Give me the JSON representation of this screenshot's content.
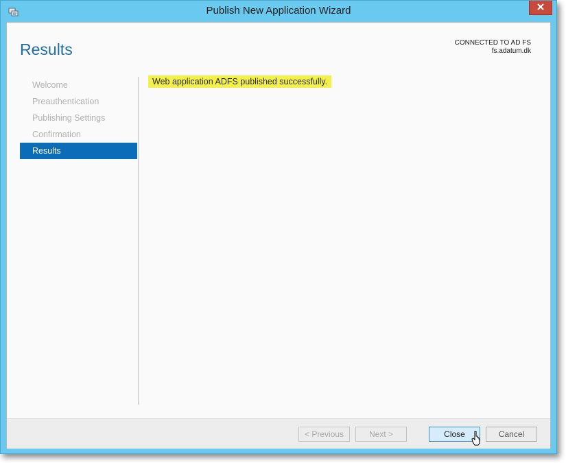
{
  "window": {
    "title": "Publish New Application Wizard",
    "icon": "wizard-app-icon",
    "close_icon": "close-icon"
  },
  "header": {
    "page_title": "Results",
    "connection_label": "CONNECTED TO AD FS",
    "connection_host": "fs.adatum.dk"
  },
  "nav": {
    "items": [
      {
        "label": "Welcome",
        "state": "disabled"
      },
      {
        "label": "Preauthentication",
        "state": "disabled"
      },
      {
        "label": "Publishing Settings",
        "state": "disabled"
      },
      {
        "label": "Confirmation",
        "state": "disabled"
      },
      {
        "label": "Results",
        "state": "active"
      }
    ]
  },
  "main": {
    "result_message": "Web application ADFS published successfully."
  },
  "footer": {
    "previous_label": "< Previous",
    "next_label": "Next >",
    "close_label": "Close",
    "cancel_label": "Cancel"
  },
  "colors": {
    "window_frame": "#6ac9ee",
    "accent": "#0b6cb8",
    "title_blue": "#1e6fa8",
    "highlight": "#f3f04a",
    "close_red": "#c74a3c"
  }
}
